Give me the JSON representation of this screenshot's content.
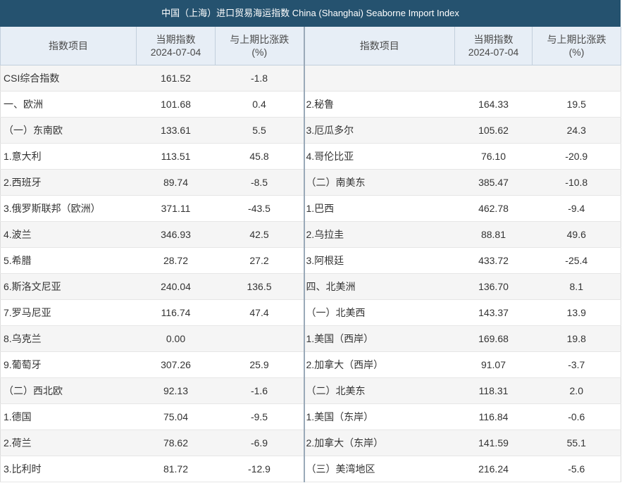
{
  "title": "中国（上海）进口贸易海运指数 China (Shanghai) Seaborne Import Index",
  "headers": {
    "item": "指数项目",
    "index_label": "当期指数",
    "index_date": "2024-07-04",
    "change_label": "与上期比涨跌",
    "change_unit": "(%)"
  },
  "rows": [
    {
      "l_name": "CSI综合指数",
      "l_index": "161.52",
      "l_change": "-1.8",
      "r_name": "",
      "r_index": "",
      "r_change": ""
    },
    {
      "l_name": "一、欧洲",
      "l_index": "101.68",
      "l_change": "0.4",
      "r_name": "2.秘鲁",
      "r_index": "164.33",
      "r_change": "19.5"
    },
    {
      "l_name": "（一）东南欧",
      "l_index": "133.61",
      "l_change": "5.5",
      "r_name": "3.厄瓜多尔",
      "r_index": "105.62",
      "r_change": "24.3"
    },
    {
      "l_name": "1.意大利",
      "l_index": "113.51",
      "l_change": "45.8",
      "r_name": "4.哥伦比亚",
      "r_index": "76.10",
      "r_change": "-20.9"
    },
    {
      "l_name": "2.西班牙",
      "l_index": "89.74",
      "l_change": "-8.5",
      "r_name": "（二）南美东",
      "r_index": "385.47",
      "r_change": "-10.8"
    },
    {
      "l_name": "3.俄罗斯联邦（欧洲）",
      "l_index": "371.11",
      "l_change": "-43.5",
      "r_name": "1.巴西",
      "r_index": "462.78",
      "r_change": "-9.4"
    },
    {
      "l_name": "4.波兰",
      "l_index": "346.93",
      "l_change": "42.5",
      "r_name": "2.乌拉圭",
      "r_index": "88.81",
      "r_change": "49.6"
    },
    {
      "l_name": "5.希腊",
      "l_index": "28.72",
      "l_change": "27.2",
      "r_name": "3.阿根廷",
      "r_index": "433.72",
      "r_change": "-25.4"
    },
    {
      "l_name": "6.斯洛文尼亚",
      "l_index": "240.04",
      "l_change": "136.5",
      "r_name": "四、北美洲",
      "r_index": "136.70",
      "r_change": "8.1"
    },
    {
      "l_name": "7.罗马尼亚",
      "l_index": "116.74",
      "l_change": "47.4",
      "r_name": "（一）北美西",
      "r_index": "143.37",
      "r_change": "13.9"
    },
    {
      "l_name": "8.乌克兰",
      "l_index": "0.00",
      "l_change": "",
      "r_name": "1.美国（西岸）",
      "r_index": "169.68",
      "r_change": "19.8"
    },
    {
      "l_name": "9.葡萄牙",
      "l_index": "307.26",
      "l_change": "25.9",
      "r_name": "2.加拿大（西岸）",
      "r_index": "91.07",
      "r_change": "-3.7"
    },
    {
      "l_name": "（二）西北欧",
      "l_index": "92.13",
      "l_change": "-1.6",
      "r_name": "（二）北美东",
      "r_index": "118.31",
      "r_change": "2.0"
    },
    {
      "l_name": "1.德国",
      "l_index": "75.04",
      "l_change": "-9.5",
      "r_name": "1.美国（东岸）",
      "r_index": "116.84",
      "r_change": "-0.6"
    },
    {
      "l_name": "2.荷兰",
      "l_index": "78.62",
      "l_change": "-6.9",
      "r_name": "2.加拿大（东岸）",
      "r_index": "141.59",
      "r_change": "55.1"
    },
    {
      "l_name": "3.比利时",
      "l_index": "81.72",
      "l_change": "-12.9",
      "r_name": "（三）美湾地区",
      "r_index": "216.24",
      "r_change": "-5.6"
    }
  ]
}
